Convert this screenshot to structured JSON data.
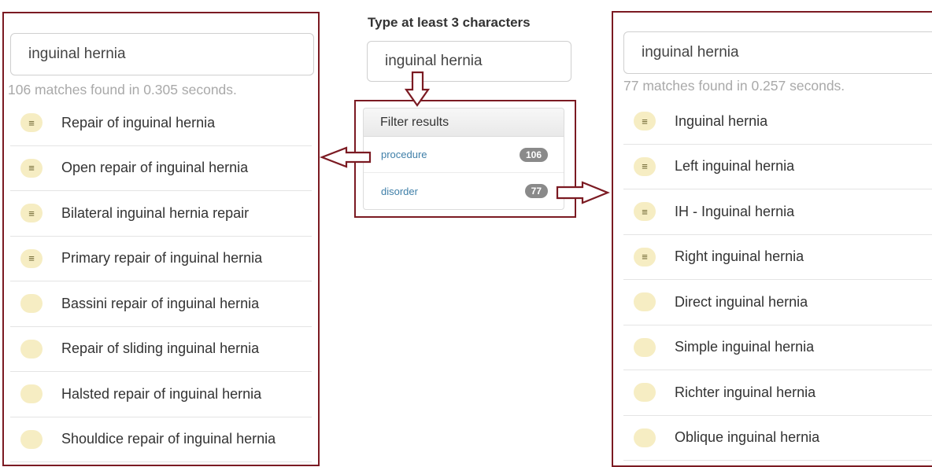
{
  "left_panel": {
    "search_value": "inguinal hernia",
    "matches_text": "106 matches found in 0.305 seconds.",
    "results": [
      {
        "label": "Repair of inguinal hernia",
        "icon": "≡"
      },
      {
        "label": "Open repair of inguinal hernia",
        "icon": "≡"
      },
      {
        "label": "Bilateral inguinal hernia repair",
        "icon": "≡"
      },
      {
        "label": "Primary repair of inguinal hernia",
        "icon": "≡"
      },
      {
        "label": "Bassini repair of inguinal hernia",
        "icon": ""
      },
      {
        "label": "Repair of sliding inguinal hernia",
        "icon": ""
      },
      {
        "label": "Halsted repair of inguinal hernia",
        "icon": ""
      },
      {
        "label": "Shouldice repair of inguinal hernia",
        "icon": ""
      }
    ]
  },
  "middle_panel": {
    "heading": "Type at least 3 characters",
    "search_value": "inguinal hernia",
    "filter": {
      "header": "Filter results",
      "rows": [
        {
          "label": "procedure",
          "count": "106"
        },
        {
          "label": "disorder",
          "count": "77"
        }
      ]
    }
  },
  "right_panel": {
    "search_value": "inguinal hernia",
    "matches_text": "77 matches found in 0.257 seconds.",
    "results": [
      {
        "label": "Inguinal hernia",
        "icon": "≡"
      },
      {
        "label": "Left inguinal hernia",
        "icon": "≡"
      },
      {
        "label": "IH - Inguinal hernia",
        "icon": "≡"
      },
      {
        "label": "Right inguinal hernia",
        "icon": "≡"
      },
      {
        "label": "Direct inguinal hernia",
        "icon": ""
      },
      {
        "label": "Simple inguinal hernia",
        "icon": ""
      },
      {
        "label": "Richter inguinal hernia",
        "icon": ""
      },
      {
        "label": "Oblique inguinal hernia",
        "icon": ""
      }
    ]
  },
  "colors": {
    "frame": "#7b1a22",
    "badge": "#f6edc3",
    "link": "#3f7fa8",
    "count_badge": "#8a8a8a"
  }
}
